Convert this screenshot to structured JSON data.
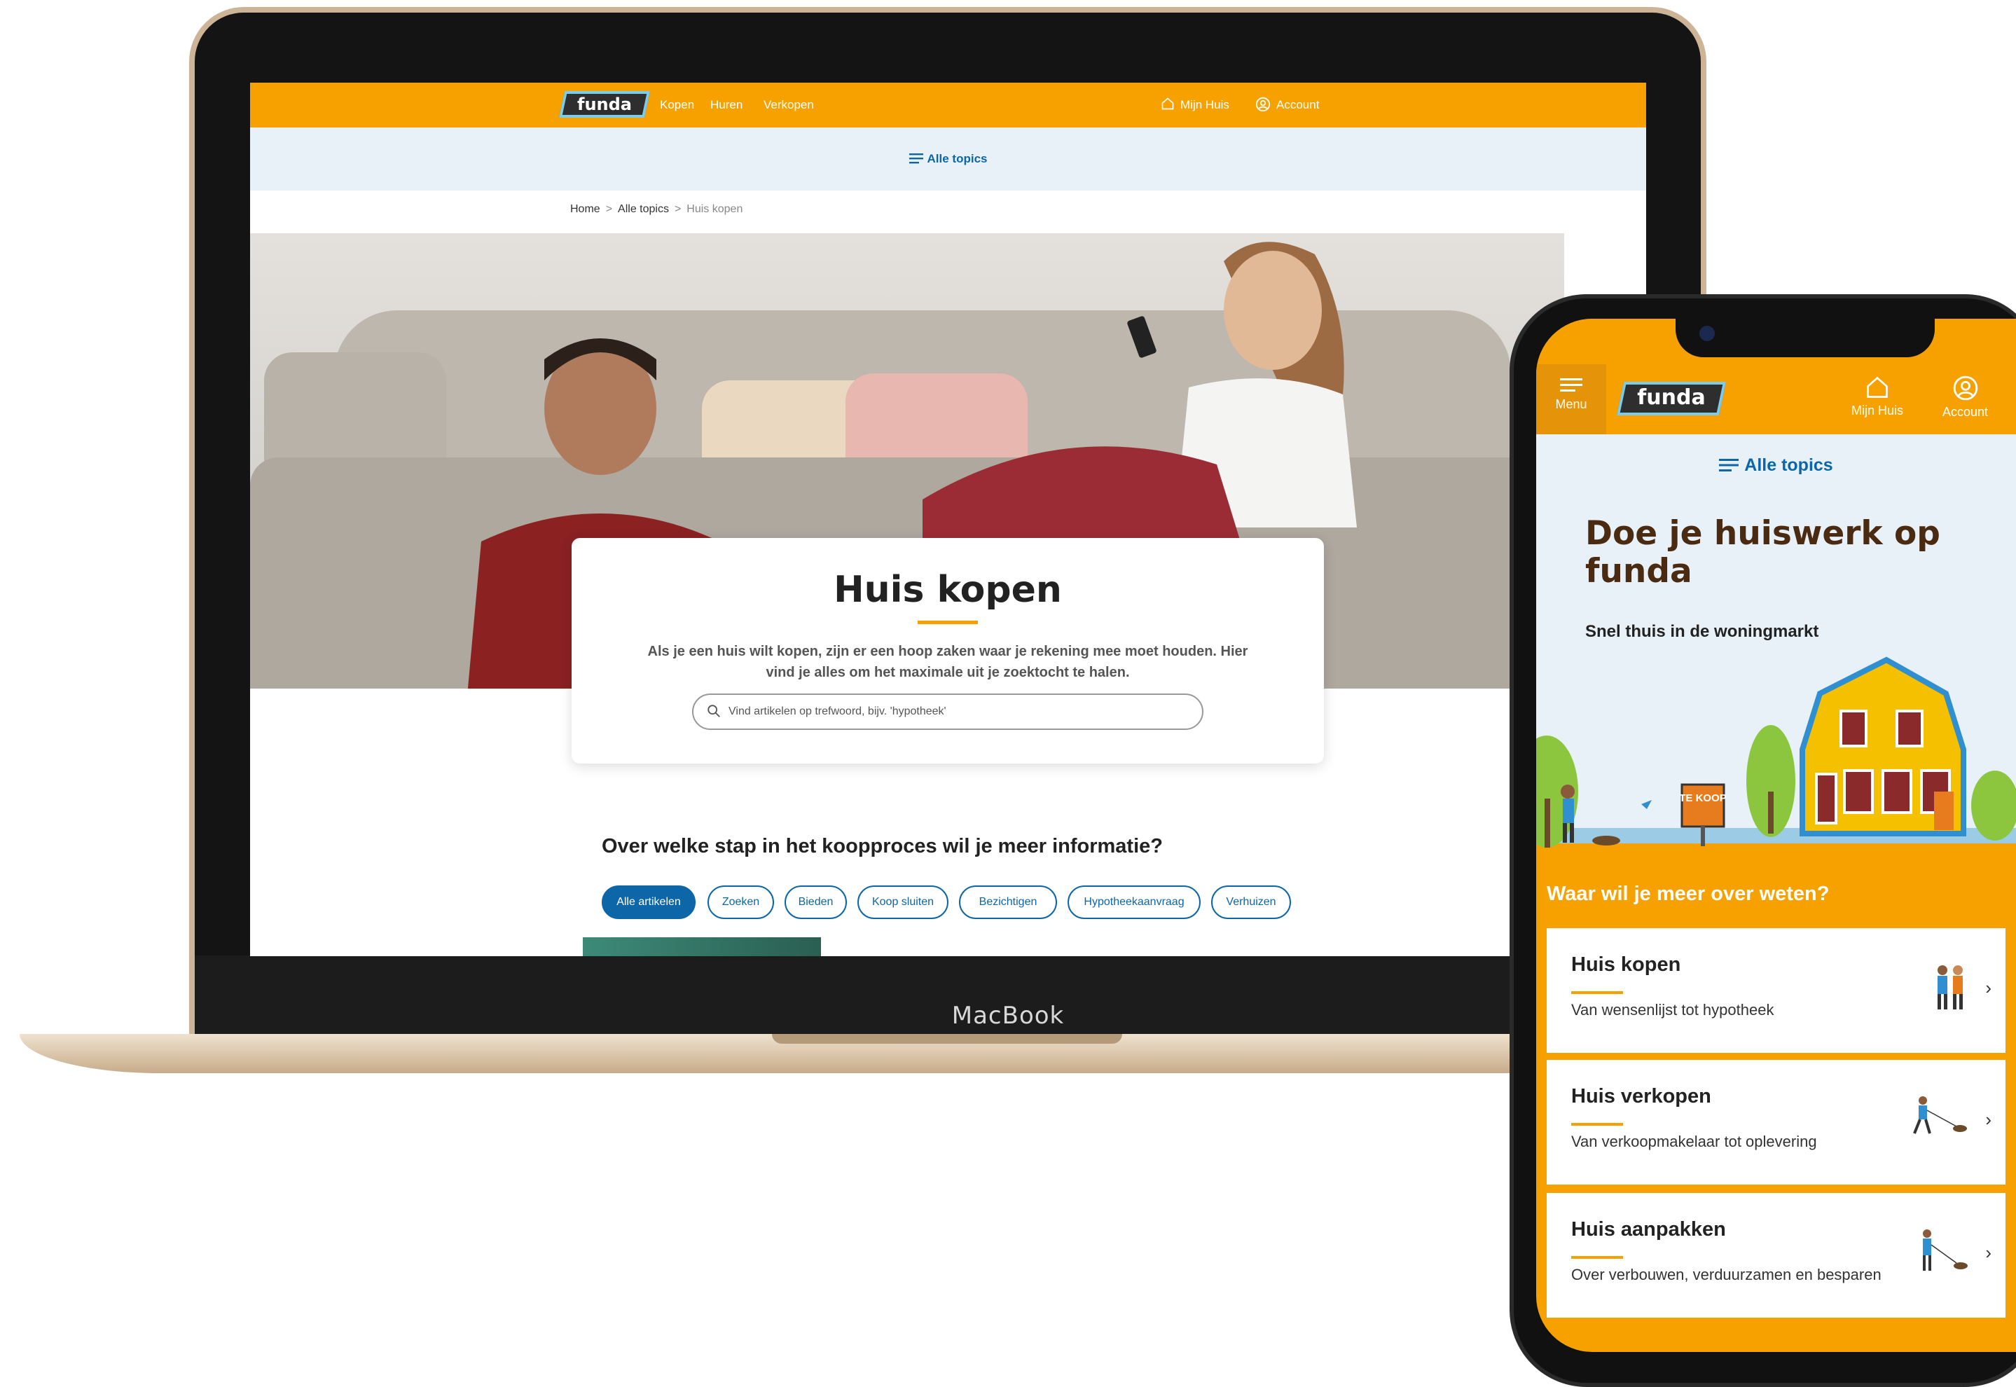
{
  "laptop": {
    "brand": "MacBook",
    "site": {
      "logo": "funda",
      "nav": [
        "Kopen",
        "Huren",
        "Verkopen"
      ],
      "mijn_huis": "Mijn Huis",
      "account": "Account",
      "all_topics": "Alle topics",
      "breadcrumb": [
        "Home",
        "Alle topics",
        "Huis kopen"
      ],
      "breadcrumb_sep": ">",
      "hero_title": "Huis kopen",
      "hero_text": "Als je een huis wilt kopen, zijn er een hoop zaken waar je rekening mee moet houden. Hier vind je alles om het maximale uit je zoektocht te halen.",
      "search_placeholder": "Vind artikelen op trefwoord, bijv. 'hypotheek'",
      "section_title": "Over welke stap in het koopproces wil je meer informatie?",
      "chips": [
        "Alle artikelen",
        "Zoeken",
        "Bieden",
        "Koop sluiten",
        "Bezichtigen",
        "Hypotheekaanvraag",
        "Verhuizen"
      ],
      "active_chip": "Alle artikelen"
    }
  },
  "phone": {
    "menu": "Menu",
    "logo": "funda",
    "mijn_huis": "Mijn Huis",
    "account": "Account",
    "all_topics": "Alle topics",
    "title": "Doe je huiswerk op funda",
    "subtitle": "Snel thuis in de woningmarkt",
    "sign": "TE KOOP",
    "question": "Waar wil je meer over weten?",
    "cards": [
      {
        "title": "Huis kopen",
        "text": "Van wensenlijst tot hypotheek"
      },
      {
        "title": "Huis verkopen",
        "text": "Van verkoopmakelaar tot oplevering"
      },
      {
        "title": "Huis aanpakken",
        "text": "Over verbouwen, verduurzamen en besparen"
      }
    ]
  },
  "colors": {
    "brand_orange": "#f7a100",
    "brand_blue": "#0c66a8",
    "light_blue": "#e8f1f8",
    "title_brown": "#4a2a10"
  }
}
